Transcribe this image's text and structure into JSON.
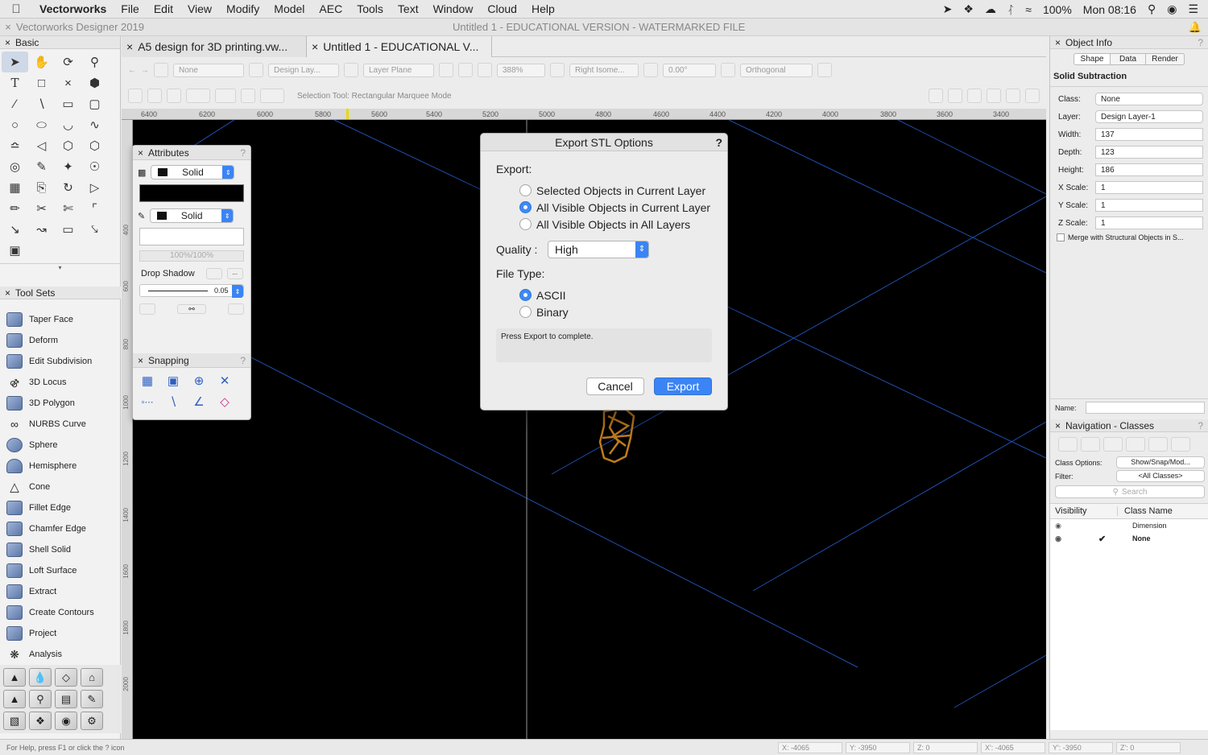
{
  "menubar": {
    "app": "Vectorworks",
    "items": [
      "File",
      "Edit",
      "View",
      "Modify",
      "Model",
      "AEC",
      "Tools",
      "Text",
      "Window",
      "Cloud",
      "Help"
    ],
    "battery": "100%",
    "clock": "Mon 08:16"
  },
  "window": {
    "app_title": "Vectorworks Designer 2019",
    "doc_title": "Untitled 1 - EDUCATIONAL VERSION - WATERMARKED FILE"
  },
  "tabs": [
    {
      "label": "A5 design for 3D printing.vw..."
    },
    {
      "label": "Untitled 1 - EDUCATIONAL V..."
    }
  ],
  "view_toolbar": {
    "class_select": "None",
    "layer_select": "Design Lay...",
    "plane_select": "Layer Plane",
    "zoom": "388%",
    "view_select": "Right Isome...",
    "angle": "0.00°",
    "projection": "Orthogonal",
    "mode_text": "Selection Tool: Rectangular Marquee Mode"
  },
  "ruler": {
    "ticks": [
      "6400",
      "6200",
      "6000",
      "5800",
      "5600",
      "5400",
      "5200",
      "5000",
      "4800",
      "4600",
      "4400",
      "4200",
      "4000",
      "3800",
      "3600",
      "3400"
    ],
    "vticks": [
      "400",
      "600",
      "800",
      "1000",
      "1200",
      "1400",
      "1600",
      "1800",
      "2000"
    ]
  },
  "basic": {
    "title": "Basic"
  },
  "toolsets": {
    "title": "Tool Sets",
    "items": [
      "Taper Face",
      "Deform",
      "Edit Subdivision",
      "3D Locus",
      "3D Polygon",
      "NURBS Curve",
      "Sphere",
      "Hemisphere",
      "Cone",
      "Fillet Edge",
      "Chamfer Edge",
      "Shell Solid",
      "Loft Surface",
      "Extract",
      "Create Contours",
      "Project",
      "Analysis"
    ]
  },
  "attributes": {
    "title": "Attributes",
    "fill_style": "Solid",
    "pen_style": "Solid",
    "opacity": "100%/100%",
    "drop_shadow": "Drop Shadow",
    "line_weight": "0.05"
  },
  "snapping": {
    "title": "Snapping"
  },
  "object_info": {
    "title": "Object Info",
    "tabs": [
      "Shape",
      "Data",
      "Render"
    ],
    "object_type": "Solid Subtraction",
    "fields": [
      {
        "label": "Class:",
        "value": "None"
      },
      {
        "label": "Layer:",
        "value": "Design Layer-1"
      },
      {
        "label": "Width:",
        "value": "137"
      },
      {
        "label": "Depth:",
        "value": "123"
      },
      {
        "label": "Height:",
        "value": "186"
      },
      {
        "label": "X Scale:",
        "value": "1"
      },
      {
        "label": "Y Scale:",
        "value": "1"
      },
      {
        "label": "Z Scale:",
        "value": "1"
      }
    ],
    "merge_label": "Merge with Structural Objects in S...",
    "name_label": "Name:"
  },
  "navigation": {
    "title": "Navigation - Classes",
    "class_options_label": "Class Options:",
    "class_options_value": "Show/Snap/Mod...",
    "filter_label": "Filter:",
    "filter_value": "<All Classes>",
    "search_placeholder": "Search",
    "col_visibility": "Visibility",
    "col_class": "Class Name",
    "rows": [
      {
        "name": "Dimension",
        "active": false
      },
      {
        "name": "None",
        "active": true
      }
    ]
  },
  "dialog": {
    "title": "Export STL Options",
    "help": "?",
    "export_label": "Export:",
    "export_options": [
      "Selected Objects in Current Layer",
      "All Visible Objects in Current Layer",
      "All Visible Objects in All Layers"
    ],
    "export_selected": 1,
    "quality_label": "Quality :",
    "quality_value": "High",
    "filetype_label": "File Type:",
    "filetype_options": [
      "ASCII",
      "Binary"
    ],
    "filetype_selected": 0,
    "message": "Press Export to complete.",
    "cancel": "Cancel",
    "export": "Export"
  },
  "status": {
    "help": "For Help, press F1 or click the ? icon",
    "coords": [
      "X: -4065",
      "Y: -3950",
      "Z: 0",
      "X': -4065",
      "Y': -3950",
      "Z': 0"
    ]
  },
  "colors": {
    "accent": "#3b84f5",
    "canvas": "#000000",
    "grid": "#1f4fae",
    "object": "#c07c1c"
  }
}
